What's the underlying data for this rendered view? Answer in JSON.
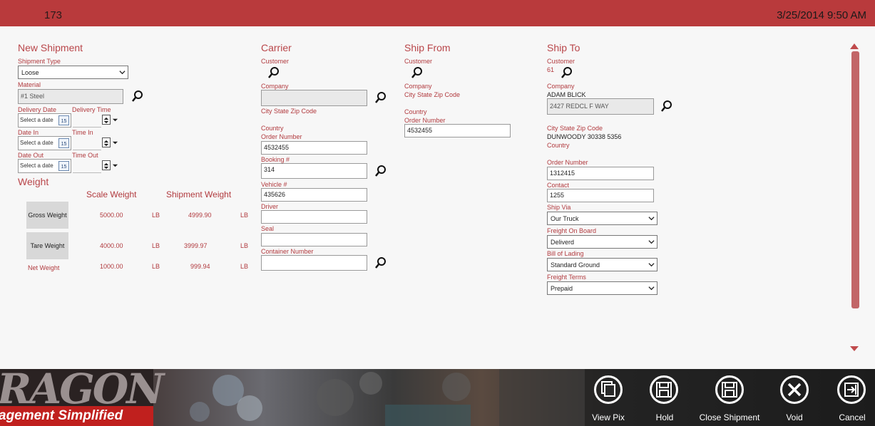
{
  "header": {
    "id": "173",
    "datetime": "3/25/2014 9:50 AM"
  },
  "new_shipment": {
    "title": "New Shipment",
    "shipment_type_label": "Shipment Type",
    "shipment_type_value": "Loose",
    "material_label": "Material",
    "material_value": "#1 Steel",
    "delivery_date_label": "Delivery Date",
    "delivery_time_label": "Delivery Time",
    "date_in_label": "Date In",
    "time_in_label": "Time In",
    "date_out_label": "Date Out",
    "time_out_label": "Time Out",
    "date_placeholder": "Select a date",
    "calendar_day": "15"
  },
  "weight": {
    "title": "Weight",
    "scale_header": "Scale Weight",
    "shipment_header": "Shipment Weight",
    "rows": [
      {
        "label": "Gross Weight",
        "scale": "5000.00",
        "unit1": "LB",
        "shipment": "4999.90",
        "unit2": "LB"
      },
      {
        "label": "Tare Weight",
        "scale": "4000.00",
        "unit1": "LB",
        "shipment": "3999.97",
        "unit2": "LB"
      },
      {
        "label": "Net Weight",
        "scale": "1000.00",
        "unit1": "LB",
        "shipment": "999.94",
        "unit2": "LB"
      }
    ]
  },
  "carrier": {
    "title": "Carrier",
    "customer_label": "Customer",
    "company_label": "Company",
    "city_label": "City State Zip Code",
    "country_label": "Country",
    "order_label": "Order Number",
    "order_value": "4532455",
    "booking_label": "Booking #",
    "booking_value": "314",
    "vehicle_label": "Vehicle #",
    "vehicle_value": "435626",
    "driver_label": "Driver",
    "seal_label": "Seal",
    "container_label": "Container Number"
  },
  "ship_from": {
    "title": "Ship From",
    "customer_label": "Customer",
    "company_label": "Company",
    "city_label": "City State Zip Code",
    "country_label": "Country",
    "order_label": "Order Number",
    "order_value": "4532455"
  },
  "ship_to": {
    "title": "Ship To",
    "customer_label": "Customer",
    "customer_value": "61",
    "company_label": "Company",
    "company_value": "ADAM BLICK",
    "address_value": "2427 REDCL F WAY",
    "city_label": "City State Zip Code",
    "city_value": "DUNWOODY 30338 5356",
    "country_label": "Country",
    "order_label": "Order Number",
    "order_value": "1312415",
    "contact_label": "Contact",
    "contact_value": "1255",
    "ship_via_label": "Ship Via",
    "ship_via_value": "Our Truck",
    "fob_label": "Freight On Board",
    "fob_value": "Deliverd",
    "bol_label": "Bill of Lading",
    "bol_value": "Standard Ground",
    "terms_label": "Freight Terms",
    "terms_value": "Prepaid"
  },
  "footer": {
    "logo_top": "RAGON",
    "logo_bottom": "agement Simplified",
    "actions": [
      {
        "label": "View Pix",
        "icon": "copy-icon"
      },
      {
        "label": "Hold",
        "icon": "save-icon"
      },
      {
        "label": "Close Shipment",
        "icon": "save-icon"
      },
      {
        "label": "Void",
        "icon": "close-icon"
      },
      {
        "label": "Cancel",
        "icon": "exit-icon"
      }
    ]
  },
  "colors": {
    "accent": "#b93a3c",
    "label": "#b13a3e",
    "footer_bg": "#2b2b2b"
  }
}
